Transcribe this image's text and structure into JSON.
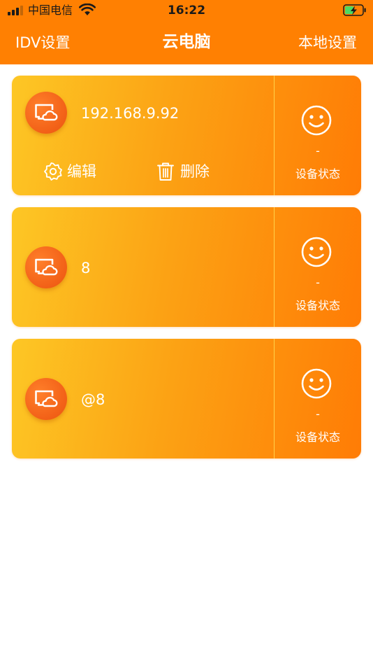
{
  "status_bar": {
    "carrier": "中国电信",
    "time": "16:22"
  },
  "nav": {
    "left_label": "IDV设置",
    "title": "云电脑",
    "right_label": "本地设置"
  },
  "devices": [
    {
      "name": "192.168.9.92",
      "status_value": "-",
      "status_label": "设备状态",
      "edit_label": "编辑",
      "delete_label": "删除"
    },
    {
      "name": "8",
      "status_value": "-",
      "status_label": "设备状态"
    },
    {
      "name": "@8",
      "status_value": "-",
      "status_label": "设备状态"
    }
  ],
  "icons": {
    "signal": "signal-icon",
    "wifi": "wifi-icon",
    "battery": "battery-charging-icon",
    "device": "cloud-computer-icon",
    "edit": "gear-icon",
    "delete": "trash-icon",
    "status": "smiley-face-icon"
  },
  "colors": {
    "brand_orange": "#ff8002",
    "card_gradient_start": "#fdc725",
    "card_gradient_end": "#ff7c05",
    "avatar": "#f26017",
    "battery_green": "#4cd964"
  }
}
